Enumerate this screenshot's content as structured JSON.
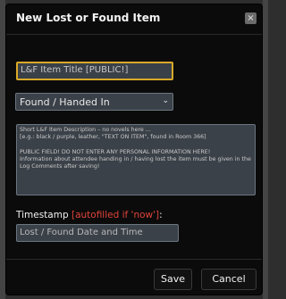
{
  "dialog": {
    "title": "New Lost or Found Item",
    "close_label": "×"
  },
  "form": {
    "title_placeholder": "L&F Item Title [PUBLIC!]",
    "status_selected": "Found / Handed In",
    "description_placeholder": "Short L&F Item Description – no novels here ...\n[e.g.: black / purple, leather, \"TEXT ON ITEM\", found in Room 366]\n\nPUBLIC FIELD! DO NOT ENTER ANY PERSONAL INFORMATION HERE!\nInformation about attendee handing in / having lost the item must be given in the Log Comments after saving!",
    "timestamp_label": "Timestamp",
    "timestamp_hint": "[autofilled if 'now']",
    "timestamp_suffix": ":",
    "timestamp_placeholder": "Lost / Found Date and Time"
  },
  "footer": {
    "save_label": "Save",
    "cancel_label": "Cancel"
  },
  "colors": {
    "accent_focus": "#d9a928",
    "hint_red": "#e0433a"
  }
}
